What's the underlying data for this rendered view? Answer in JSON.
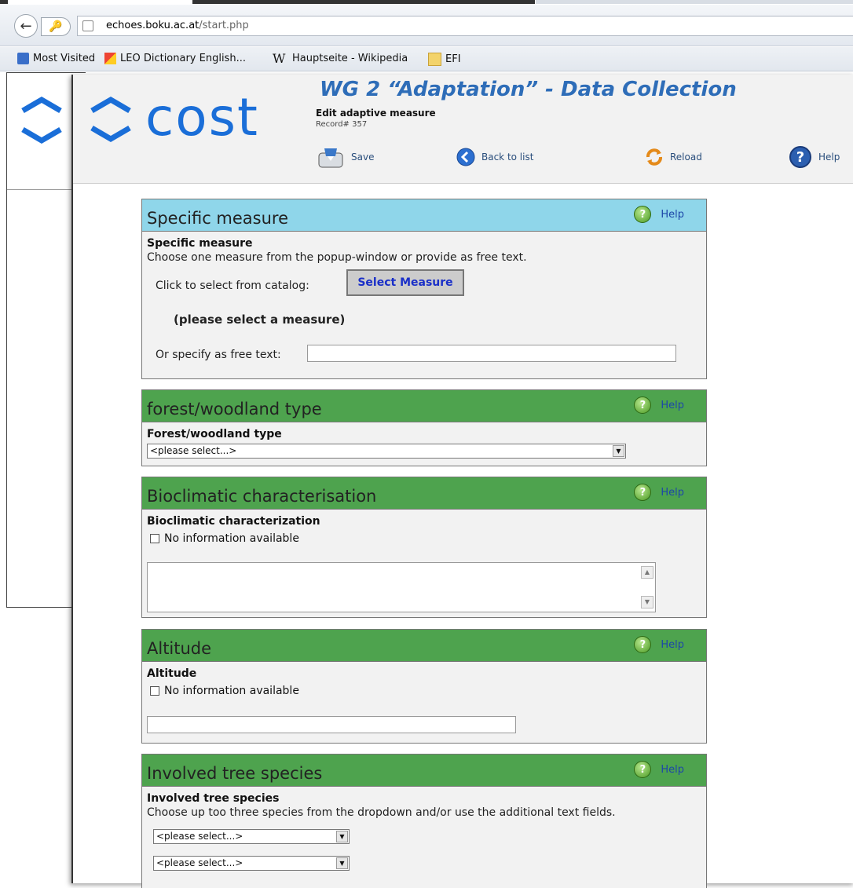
{
  "browser": {
    "url_domain": "echoes.boku.ac.at",
    "url_path": "/start.php",
    "bookmarks": [
      {
        "label": "Most Visited",
        "icon": "most-visited-icon"
      },
      {
        "label": "LEO Dictionary English...",
        "icon": "leo-icon"
      },
      {
        "label": "Hauptseite - Wikipedia",
        "icon": "wikipedia-icon"
      },
      {
        "label": "EFI",
        "icon": "folder-icon"
      }
    ]
  },
  "header": {
    "logo_text": "cost",
    "title": "WG 2 “Adaptation” - Data Collection",
    "subtitle": "Edit adaptive measure",
    "record": "Record# 357",
    "toolbar": {
      "save": "Save",
      "back": "Back to list",
      "reload": "Reload",
      "help": "Help"
    },
    "colors": {
      "title": "#2e6db8",
      "logo": "#1a6ed8"
    }
  },
  "sections": {
    "help_label": "Help",
    "specific": {
      "title": "Specific measure",
      "label": "Specific measure",
      "desc": "Choose one measure from the popup-window or provide as free text.",
      "catalog_label": "Click to select from catalog:",
      "select_button": "Select Measure",
      "selected_note": "(please select a measure)",
      "free_text_label": "Or specify as free text:",
      "free_text_value": ""
    },
    "forest": {
      "title": "forest/woodland type",
      "label": "Forest/woodland type",
      "select_value": "<please select...>"
    },
    "bioclimatic": {
      "title": "Bioclimatic characterisation",
      "label": "Bioclimatic characterization",
      "no_info": "No information available",
      "text_value": ""
    },
    "altitude": {
      "title": "Altitude",
      "label": "Altitude",
      "no_info": "No information available",
      "value": ""
    },
    "species": {
      "title": "Involved tree species",
      "label": "Involved tree species",
      "desc": "Choose up too three species from the dropdown and/or use the additional text fields.",
      "select1": "<please select...>",
      "select2": "<please select...>"
    }
  }
}
